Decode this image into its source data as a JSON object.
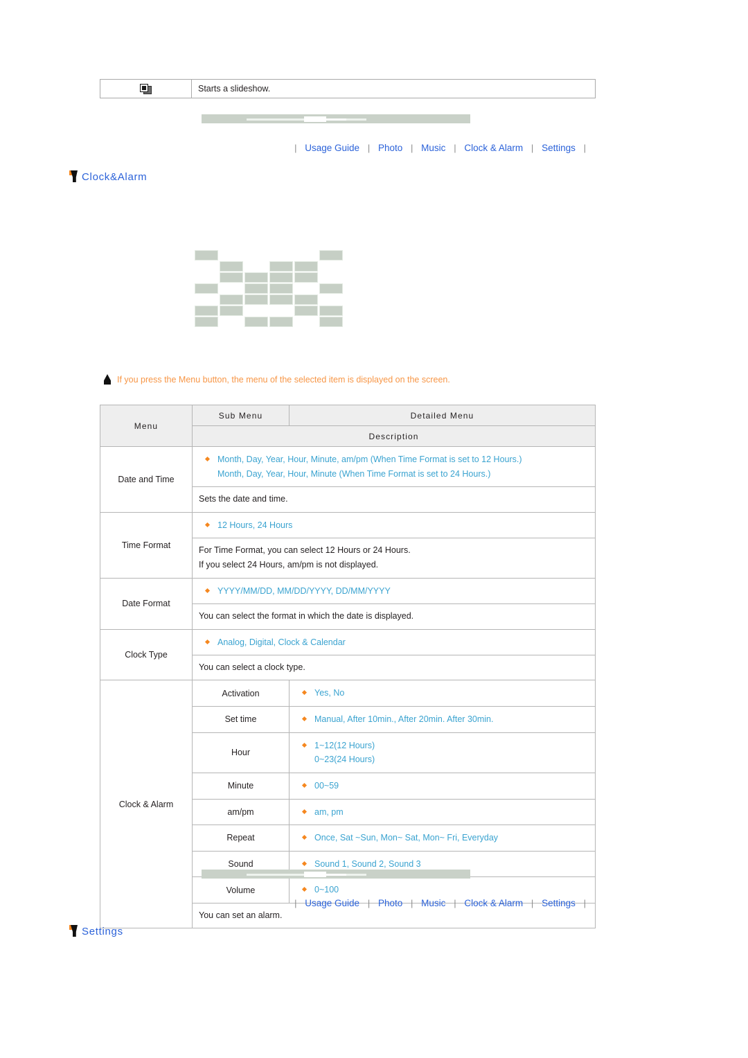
{
  "top_table": {
    "icon": "slideshow-icon",
    "description": "Starts a slideshow."
  },
  "nav": {
    "separator": "|",
    "items": [
      {
        "label": "Usage Guide"
      },
      {
        "label": "Photo"
      },
      {
        "label": "Music"
      },
      {
        "label": "Clock & Alarm"
      },
      {
        "label": "Settings"
      }
    ]
  },
  "headings": {
    "clock_alarm": "Clock&Alarm",
    "settings": "Settings"
  },
  "note": {
    "text": "If you press the Menu button, the menu of the selected item is displayed on the screen."
  },
  "table": {
    "headers": {
      "menu": "Menu",
      "sub_menu": "Sub Menu",
      "detailed_menu": "Detailed Menu",
      "description": "Description"
    },
    "rows": [
      {
        "menu": "Date and Time",
        "sub_menu": "",
        "details": [
          "Month, Day, Year, Hour, Minute, am/pm (When Time Format is set to 12 Hours.)",
          "Month, Day, Year, Hour, Minute (When Time Format is set to 24 Hours.)"
        ],
        "description": [
          "Sets the date and time."
        ]
      },
      {
        "menu": "Time Format",
        "sub_menu": "",
        "details": [
          "12 Hours, 24 Hours"
        ],
        "description": [
          "For Time Format, you can select 12 Hours or 24 Hours.",
          "If you select 24 Hours, am/pm is not displayed."
        ]
      },
      {
        "menu": "Date Format",
        "sub_menu": "",
        "details": [
          "YYYY/MM/DD, MM/DD/YYYY, DD/MM/YYYY"
        ],
        "description": [
          "You can select the format in which the date is displayed."
        ]
      },
      {
        "menu": "Clock Type",
        "sub_menu": "",
        "details": [
          "Analog, Digital, Clock & Calendar"
        ],
        "description": [
          "You can select a clock type."
        ]
      }
    ],
    "clock_alarm_group": {
      "menu": "Clock & Alarm",
      "sub_rows": [
        {
          "sub_menu": "Activation",
          "details": [
            "Yes, No"
          ]
        },
        {
          "sub_menu": "Set time",
          "details": [
            "Manual, After 10min., After 20min. After 30min."
          ]
        },
        {
          "sub_menu": "Hour",
          "details": [
            "1~12(12 Hours)",
            "0~23(24 Hours)"
          ]
        },
        {
          "sub_menu": "Minute",
          "details": [
            "00~59"
          ]
        },
        {
          "sub_menu": "am/pm",
          "details": [
            "am, pm"
          ]
        },
        {
          "sub_menu": "Repeat",
          "details": [
            "Once, Sat ~Sun, Mon~ Sat, Mon~ Fri, Everyday"
          ]
        },
        {
          "sub_menu": "Sound",
          "details": [
            "Sound 1, Sound 2, Sound 3"
          ]
        },
        {
          "sub_menu": "Volume",
          "details": [
            "0~100"
          ]
        }
      ],
      "description": [
        "You can set an alarm."
      ]
    }
  },
  "colors": {
    "nav_link": "#2b62d9",
    "detail_text": "#3aa3d0",
    "note_text": "#f79646",
    "bullet_orange": "#f5871f",
    "divider_bar": "#c9d1c8",
    "placeholder_tile": "#c6cfc5",
    "header_bg": "#eeeeee",
    "border": "#b5b5b5"
  }
}
